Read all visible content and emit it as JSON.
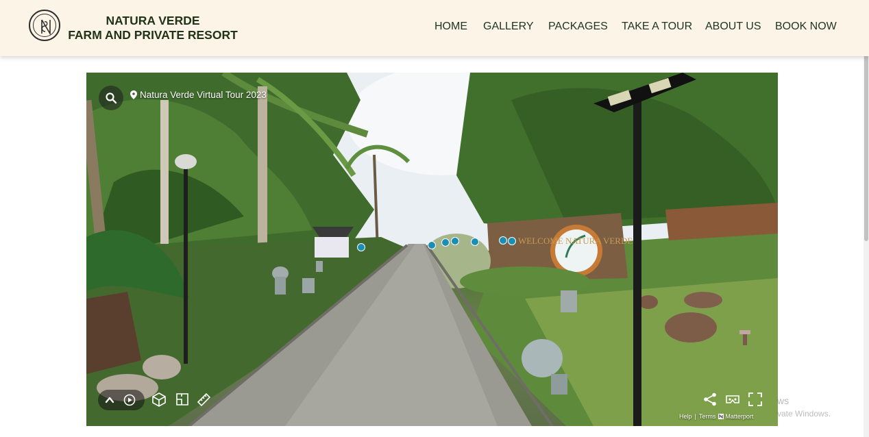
{
  "brand": {
    "line1": "NATURA VERDE",
    "line2": "FARM AND PRIVATE RESORT"
  },
  "nav": {
    "items": [
      {
        "label": "HOME"
      },
      {
        "label": "GALLERY"
      },
      {
        "label": "PACKAGES"
      },
      {
        "label": "TAKE A TOUR"
      },
      {
        "label": "ABOUT US"
      },
      {
        "label": "BOOK NOW"
      }
    ]
  },
  "tour": {
    "title": "Natura Verde Virtual Tour 2023",
    "footer_help": "Help",
    "footer_sep": "|",
    "footer_terms": "Terms",
    "footer_brand": "Matterport",
    "sign_text": "WELCOME NATURA VERDE"
  },
  "os_watermark": {
    "line1": "ws",
    "line2": "vate Windows."
  },
  "colors": {
    "header_bg": "#fbf4e7",
    "nav_text": "#1f3320",
    "tag_blue": "#1b8fb3"
  }
}
